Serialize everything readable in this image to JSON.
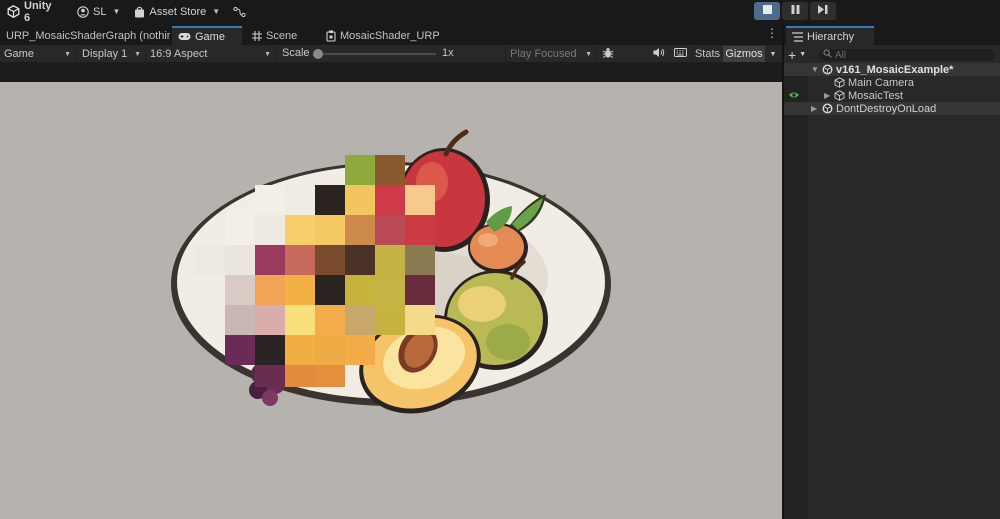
{
  "toolbar": {
    "app_name": "Unity 6",
    "account": "SL",
    "asset_store": "Asset Store",
    "icons": [
      "unity-logo-icon",
      "account-icon",
      "store-bag-icon",
      "version-control-icon",
      "stop-icon",
      "pause-icon",
      "step-icon"
    ]
  },
  "tabs": [
    {
      "label": "URP_MosaicShaderGraph (nothir",
      "icon": ""
    },
    {
      "label": "Game",
      "icon": "gamepad-icon",
      "active": true
    },
    {
      "label": "Scene",
      "icon": "grid-icon"
    },
    {
      "label": "MosaicShader_URP",
      "icon": "shader-graph-icon"
    }
  ],
  "gamebar": {
    "view_mode": "Game",
    "display": "Display 1",
    "aspect": "16:9 Aspect",
    "scale_label": "Scale",
    "scale_value": "1x",
    "play_mode": "Play Focused",
    "stats": "Stats",
    "gizmos": "Gizmos"
  },
  "hierarchy": {
    "tab_label": "Hierarchy",
    "search_placeholder": "All",
    "items": [
      {
        "label": "v161_MosaicExample*",
        "type": "scene",
        "expanded": true
      },
      {
        "label": "Main Camera",
        "type": "gameobject",
        "depth": 1
      },
      {
        "label": "MosaicTest",
        "type": "gameobject",
        "depth": 1,
        "collapsed": true
      },
      {
        "label": "DontDestroyOnLoad",
        "type": "scene",
        "collapsed": true
      }
    ]
  },
  "colors": {
    "accent": "#3a79bb",
    "play_active": "#4e6a8c",
    "viewport_bg": "#b6b2ad",
    "panel_bg": "#282828"
  }
}
